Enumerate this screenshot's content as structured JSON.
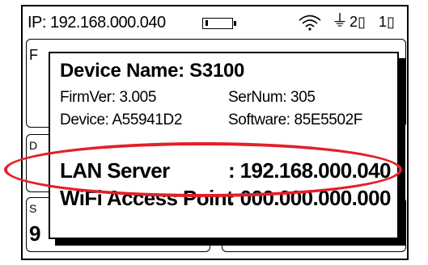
{
  "status_bar": {
    "ip_label": "IP: 192.168.000.040",
    "battery_icon": "battery-icon",
    "wifi_icon": "wifi-icon",
    "plug_icon": "plug-icon",
    "port1": "2▯",
    "port2": "1▯"
  },
  "background": {
    "frag1": "F",
    "frag2": "D",
    "frag3": "S",
    "frag4": "9"
  },
  "device_info": {
    "title": "Device Name:  S3100",
    "firmware": "FirmVer:  3.005",
    "serial": "SerNum:  305",
    "device": "Device:  A55941D2",
    "software": "Software:  85E5502F",
    "lan_label": "LAN Server",
    "lan_value": ": 192.168.000.040",
    "wifi_label": "WiFi Access Point",
    "wifi_value": ": 000.000.000.000"
  },
  "colors": {
    "highlight": "#e3202a"
  }
}
